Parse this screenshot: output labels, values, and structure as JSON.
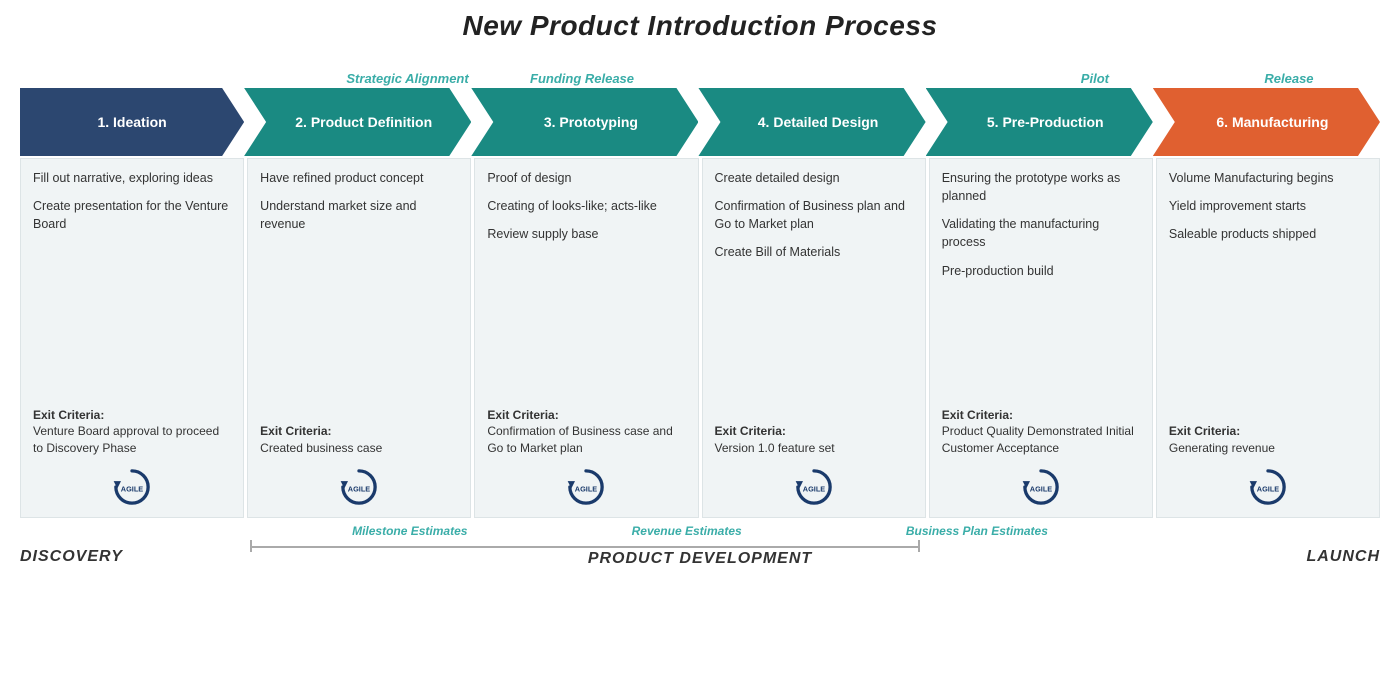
{
  "title": "New Product Introduction  Process",
  "gate_labels": [
    {
      "label": "Strategic Alignment",
      "left": "24%"
    },
    {
      "label": "Funding Release",
      "left": "37.5%"
    },
    {
      "label": "Pilot",
      "left": "78%"
    },
    {
      "label": "Release",
      "left": "91.5%"
    }
  ],
  "phases": [
    {
      "id": "ideation",
      "number": "1.",
      "name": "Ideation",
      "color": "#2c4770"
    },
    {
      "id": "definition",
      "number": "2.",
      "name": "Product\nDefinition",
      "color": "#1a8a82"
    },
    {
      "id": "prototyping",
      "number": "3.",
      "name": "Prototyping",
      "color": "#1a8a82"
    },
    {
      "id": "detailed",
      "number": "4.",
      "name": "Detailed\nDesign",
      "color": "#1a8a82"
    },
    {
      "id": "preproduction",
      "number": "5.",
      "name": "Pre-Production",
      "color": "#1a8a82"
    },
    {
      "id": "manufacturing",
      "number": "6.",
      "name": "Manufacturing",
      "color": "#e06030"
    }
  ],
  "cards": [
    {
      "id": "ideation",
      "items": [
        "Fill out narrative, exploring ideas",
        "Create presentation for the Venture Board"
      ],
      "exit_label": "Exit Criteria:",
      "exit_text": "Venture Board approval to proceed to Discovery Phase"
    },
    {
      "id": "definition",
      "items": [
        "Have refined product concept",
        "Understand market size and revenue"
      ],
      "exit_label": "Exit Criteria:",
      "exit_text": "Created business case"
    },
    {
      "id": "prototyping",
      "items": [
        "Proof of design",
        "Creating of looks-like; acts-like",
        "Review supply base"
      ],
      "exit_label": "Exit Criteria:",
      "exit_text": "Confirmation of Business case and Go to Market plan"
    },
    {
      "id": "detailed",
      "items": [
        "Create detailed design",
        "Confirmation of Business plan and Go to Market plan",
        "Create Bill of Materials"
      ],
      "exit_label": "Exit Criteria:",
      "exit_text": "Version 1.0 feature set"
    },
    {
      "id": "preproduction",
      "items": [
        "Ensuring the prototype works as planned",
        "Validating the manufacturing process",
        "Pre-production build"
      ],
      "exit_label": "Exit Criteria:",
      "exit_text": "Product Quality Demonstrated Initial Customer Acceptance"
    },
    {
      "id": "manufacturing",
      "items": [
        "Volume Manufacturing begins",
        "Yield improvement starts",
        "Saleable products shipped"
      ],
      "exit_label": "Exit Criteria:",
      "exit_text": "Generating revenue"
    }
  ],
  "bottom": {
    "discovery_label": "DISCOVERY",
    "product_dev_label": "PRODUCT DEVELOPMENT",
    "launch_label": "LAUNCH",
    "milestone_labels": [
      "Milestone Estimates",
      "Revenue Estimates",
      "Business Plan Estimates"
    ]
  },
  "agile_label": "AGILE"
}
